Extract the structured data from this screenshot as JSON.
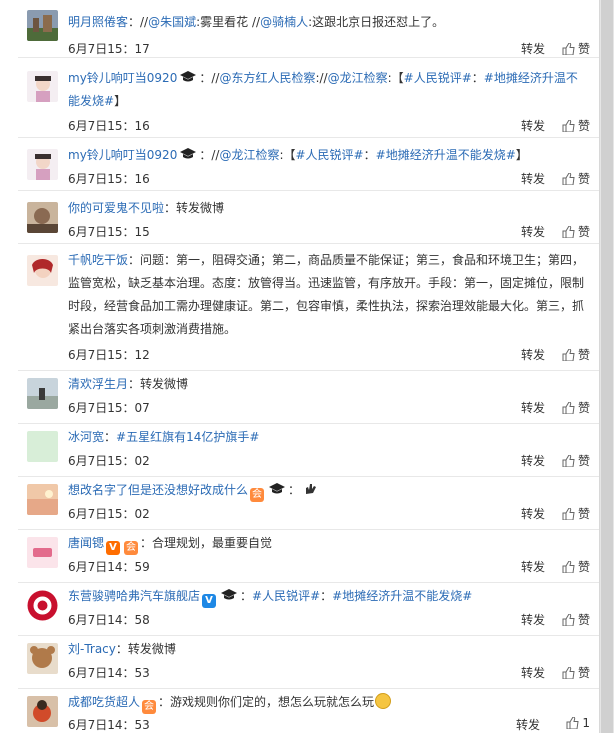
{
  "actions": {
    "repost": "转发",
    "like": "赞"
  },
  "comments": [
    {
      "user": "明月照倦客",
      "segments": [
        {
          "t": "：//",
          "k": "plain"
        },
        {
          "t": "@朱国斌",
          "k": "mention"
        },
        {
          "t": ":雾里看花 //",
          "k": "plain"
        },
        {
          "t": "@骑楠人",
          "k": "mention"
        },
        {
          "t": ":这跟北京日报还怼上了。",
          "k": "plain"
        }
      ],
      "time": "6月7日15：17",
      "likes": ""
    },
    {
      "user": "my铃儿响叮当0920",
      "segments": [
        {
          "t": "：//",
          "k": "plain"
        },
        {
          "t": "@东方红人民检察",
          "k": "mention"
        },
        {
          "t": "://",
          "k": "plain"
        },
        {
          "t": "@龙江检察",
          "k": "mention"
        },
        {
          "t": ":【",
          "k": "plain"
        },
        {
          "t": "#人民锐评#",
          "k": "mention"
        },
        {
          "t": "：",
          "k": "plain"
        },
        {
          "t": "#地摊经济升温不能发烧#",
          "k": "mention"
        },
        {
          "t": "】",
          "k": "plain"
        }
      ],
      "time": "6月7日15：16",
      "likes": ""
    },
    {
      "user": "my铃儿响叮当0920",
      "segments": [
        {
          "t": "：//",
          "k": "plain"
        },
        {
          "t": "@龙江检察",
          "k": "mention"
        },
        {
          "t": ":【",
          "k": "plain"
        },
        {
          "t": "#人民锐评#",
          "k": "mention"
        },
        {
          "t": "：",
          "k": "plain"
        },
        {
          "t": "#地摊经济升温不能发烧#",
          "k": "mention"
        },
        {
          "t": "】",
          "k": "plain"
        }
      ],
      "time": "6月7日15：16",
      "likes": ""
    },
    {
      "user": "你的可爱鬼不见啦",
      "segments": [
        {
          "t": "：转发微博",
          "k": "plain"
        }
      ],
      "time": "6月7日15：15",
      "likes": ""
    },
    {
      "user": "千帆吃干饭",
      "segments": [
        {
          "t": "：问题：第一，阻碍交通；第二，商品质量不能保证；第三，食品和环境卫生；第四，监管宽松，缺乏基本治理。态度：放管得当。迅速监管，有序放开。手段：第一，固定摊位，限制时段，经营食品加工需办理健康证。第二，包容审慎，柔性执法，探索治理效能最大化。第三，抓紧出台落实各项刺激消费措施。",
          "k": "plain"
        }
      ],
      "time": "6月7日15：12",
      "likes": ""
    },
    {
      "user": "清欢浮生月",
      "segments": [
        {
          "t": "：转发微博",
          "k": "plain"
        }
      ],
      "time": "6月7日15：07",
      "likes": ""
    },
    {
      "user": "冰河宽",
      "segments": [
        {
          "t": "：",
          "k": "plain"
        },
        {
          "t": "#五星红旗有14亿护旗手#",
          "k": "mention"
        }
      ],
      "time": "6月7日15：02",
      "likes": ""
    },
    {
      "user": "想改名字了但是还没想好改成什么",
      "segments": [
        {
          "t": "：",
          "k": "plain"
        }
      ],
      "time": "6月7日15：02",
      "likes": ""
    },
    {
      "user": "唐闻锶",
      "segments": [
        {
          "t": "：合理规划，最重要自觉",
          "k": "plain"
        }
      ],
      "time": "6月7日14：59",
      "likes": ""
    },
    {
      "user": "东营骏骋哈弗汽车旗舰店",
      "segments": [
        {
          "t": "：",
          "k": "plain"
        },
        {
          "t": "#人民锐评#",
          "k": "mention"
        },
        {
          "t": "：",
          "k": "plain"
        },
        {
          "t": "#地摊经济升温不能发烧#",
          "k": "mention"
        }
      ],
      "time": "6月7日14：58",
      "likes": ""
    },
    {
      "user": "刘-Tracy",
      "segments": [
        {
          "t": "：转发微博",
          "k": "plain"
        }
      ],
      "time": "6月7日14：53",
      "likes": ""
    },
    {
      "user": "成都吃货超人",
      "segments": [
        {
          "t": "：游戏规则你们定的，想怎么玩就怎么玩",
          "k": "plain"
        }
      ],
      "time": "6月7日14：53",
      "likes": "1"
    }
  ],
  "colors": {
    "link": "#2b6bb5",
    "text": "#333333",
    "divider": "#e8e8e8"
  }
}
